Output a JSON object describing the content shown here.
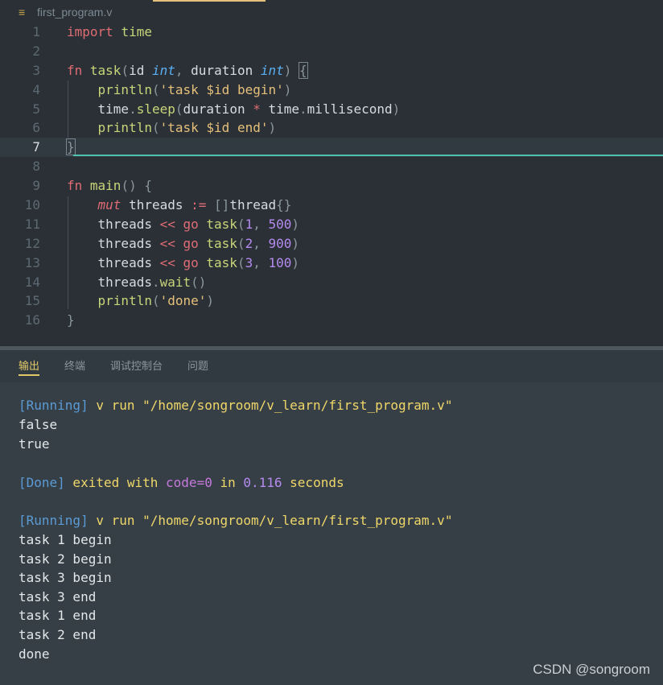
{
  "editor": {
    "file_name": "first_program.v",
    "line_numbers": [
      "1",
      "2",
      "3",
      "4",
      "5",
      "6",
      "7",
      "8",
      "9",
      "10",
      "11",
      "12",
      "13",
      "14",
      "15",
      "16"
    ]
  },
  "panel": {
    "tabs": [
      "输出",
      "终端",
      "调试控制台",
      "问题"
    ]
  },
  "output": {
    "run1_tag": "[Running]",
    "run1_cmd": " v run \"/home/songroom/v_learn/first_program.v\"",
    "run1_lines": [
      "false",
      "true"
    ],
    "done_tag": "[Done]",
    "done_text1": " exited with ",
    "done_code": "code=0",
    "done_in": " in ",
    "done_time": "0.116",
    "done_seconds": " seconds",
    "run2_tag": "[Running]",
    "run2_cmd": " v run \"/home/songroom/v_learn/first_program.v\"",
    "run2_lines": [
      "task 1 begin",
      "task 2 begin",
      "task 3 begin",
      "task 3 end",
      "task 1 end",
      "task 2 end",
      "done"
    ]
  },
  "watermark": "CSDN @songroom"
}
